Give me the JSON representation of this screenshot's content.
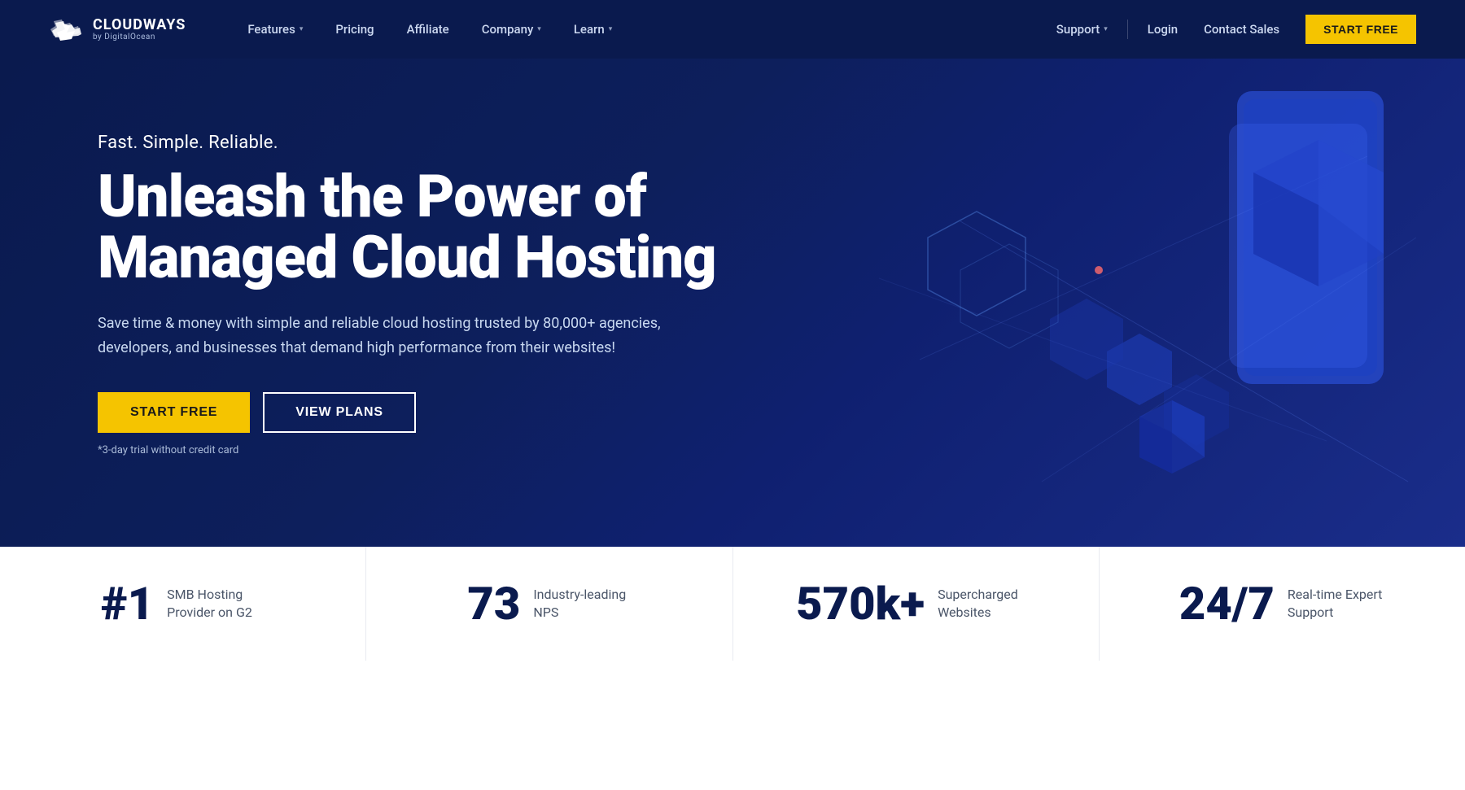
{
  "brand": {
    "name": "CLOUDWAYS",
    "sub": "by DigitalOcean",
    "logo_icon": "cloud-icon"
  },
  "navbar": {
    "features_label": "Features",
    "pricing_label": "Pricing",
    "affiliate_label": "Affiliate",
    "company_label": "Company",
    "learn_label": "Learn",
    "support_label": "Support",
    "login_label": "Login",
    "contact_label": "Contact Sales",
    "start_free_label": "START FREE"
  },
  "hero": {
    "tagline": "Fast. Simple. Reliable.",
    "title_line1": "Unleash the Power of",
    "title_line2": "Managed Cloud Hosting",
    "description": "Save time & money with simple and reliable cloud hosting trusted by 80,000+ agencies, developers, and businesses that demand high performance from their websites!",
    "start_free_label": "START FREE",
    "view_plans_label": "VIEW PLANS",
    "trial_note": "*3-day trial without credit card"
  },
  "stats": [
    {
      "number": "#1",
      "label": "SMB Hosting Provider on G2"
    },
    {
      "number": "73",
      "label": "Industry-leading NPS"
    },
    {
      "number": "570k+",
      "label": "Supercharged Websites"
    },
    {
      "number": "24/7",
      "label": "Real-time Expert Support"
    }
  ],
  "colors": {
    "navy": "#0a1a4e",
    "yellow": "#f5c400",
    "white": "#ffffff",
    "light_blue": "#ccd8f0"
  }
}
